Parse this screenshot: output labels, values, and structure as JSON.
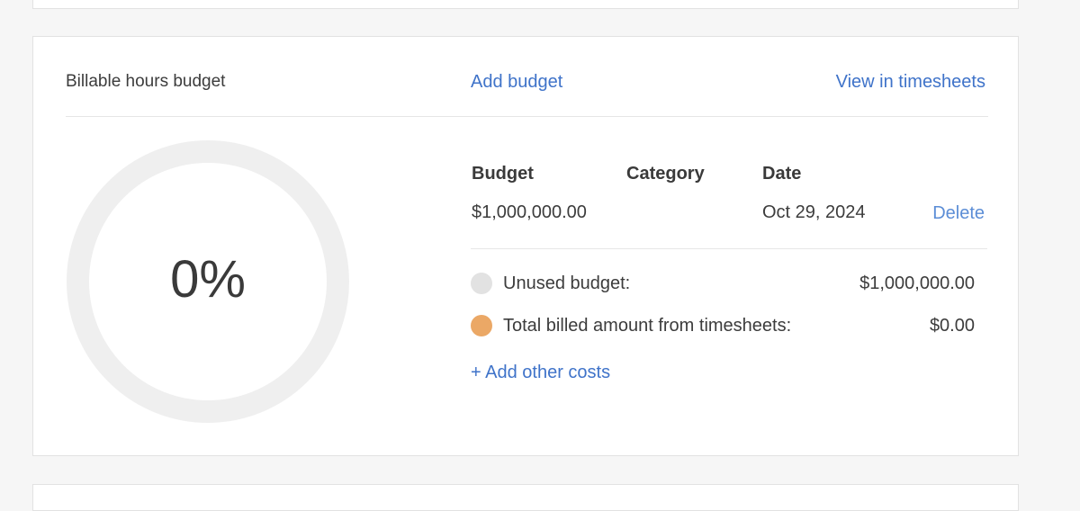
{
  "card": {
    "title": "Billable hours budget",
    "add_budget_label": "Add budget",
    "view_timesheets_label": "View in timesheets",
    "progress_text": "0%",
    "progress_percent": 0,
    "table": {
      "headers": [
        "Budget",
        "Category",
        "Date"
      ],
      "rows": [
        {
          "budget": "$1,000,000.00",
          "category": "",
          "date": "Oct 29, 2024",
          "action": "Delete"
        }
      ]
    },
    "legend": [
      {
        "label": "Unused budget:",
        "value": "$1,000,000.00",
        "color": "#e2e2e2"
      },
      {
        "label": "Total billed amount from timesheets:",
        "value": "$0.00",
        "color": "#eba866"
      }
    ],
    "add_costs_label": "+ Add other costs"
  },
  "colors": {
    "link": "#3f73c9",
    "ring": "#efefef"
  }
}
